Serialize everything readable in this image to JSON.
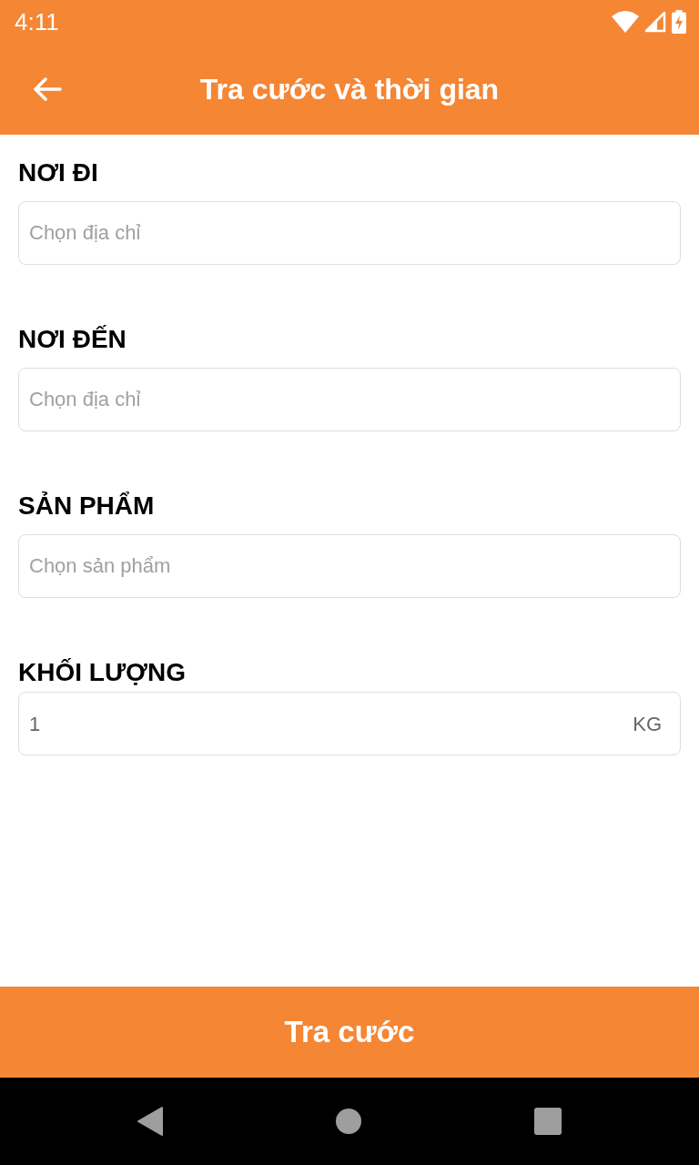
{
  "status_bar": {
    "time": "4:11"
  },
  "header": {
    "title": "Tra cước và thời gian"
  },
  "fields": [
    {
      "kind": "select",
      "label": "NƠI ĐI",
      "placeholder": "Chọn địa chỉ"
    },
    {
      "kind": "select",
      "label": "NƠI ĐẾN",
      "placeholder": "Chọn địa chỉ"
    },
    {
      "kind": "select",
      "label": "SẢN PHẨM",
      "placeholder": "Chọn sản phẩm"
    },
    {
      "kind": "number",
      "label": "KHỐI LƯỢNG",
      "value": "1",
      "unit": "KG"
    }
  ],
  "submit_button": {
    "label": "Tra cước"
  }
}
